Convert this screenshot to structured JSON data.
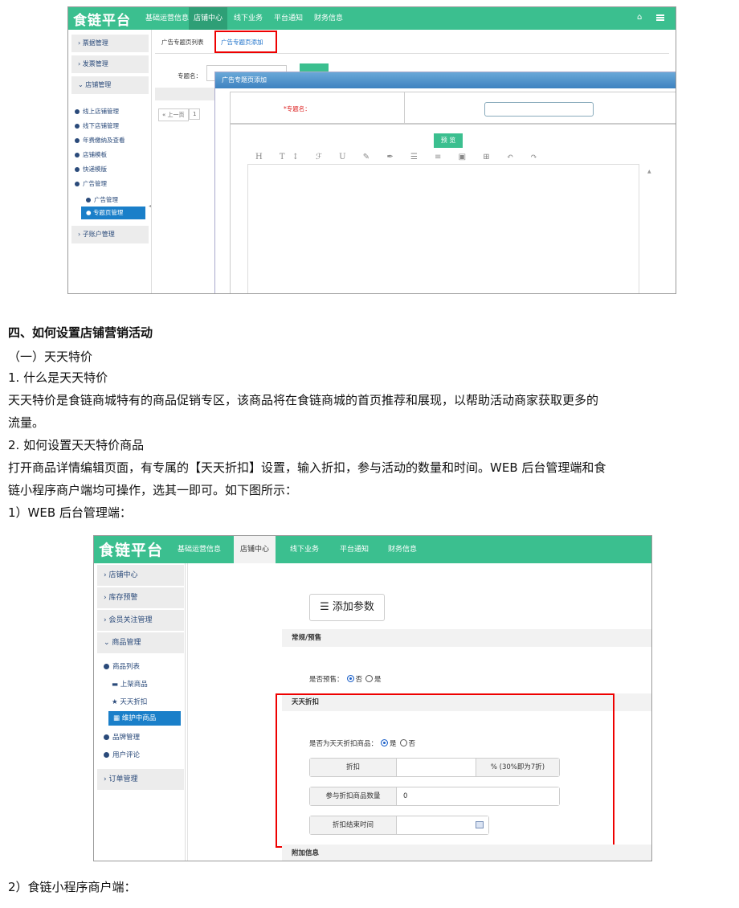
{
  "shot1": {
    "logo": "食链平台",
    "nav": [
      "基础运营信息",
      "店铺中心",
      "线下业务",
      "平台通知",
      "财务信息"
    ],
    "sidebar_sections": [
      "票据管理",
      "发票管理",
      "店铺管理",
      "子账户管理"
    ],
    "sidebar_items": [
      "线上店铺管理",
      "线下店铺管理",
      "年费缴纳及查看",
      "店铺模板",
      "快递模版",
      "广告管理",
      "广告管理"
    ],
    "sidebar_selected": "专题页管理",
    "tabs": [
      "广告专题页列表",
      "广告专题页添加"
    ],
    "filter_label": "专题名：",
    "pager_prev": "« 上一页",
    "pager_page": "1",
    "modal_title": "广告专题页添加",
    "required_label": "*专题名：",
    "preview_button": "预 览",
    "toolbar_glyphs": "H T↕ ℱ U ✎ ✒ ☰ ≡ ▣ ⊞ ↶ ↷"
  },
  "section": {
    "heading": "四、如何设置店铺营销活动",
    "sub1": "（一）天天特价",
    "q1": "1. 什么是天天特价",
    "p1_line1": "天天特价是食链商城特有的商品促销专区，该商品将在食链商城的首页推荐和展现，以帮助活动商家获取更多的",
    "p1_line2": "流量。",
    "q2": "2. 如何设置天天特价商品",
    "p2_line1": "打开商品详情编辑页面，有专属的【天天折扣】设置，输入折扣，参与活动的数量和时间。WEB 后台管理端和食",
    "p2_line2": "链小程序商户端均可操作，选其一即可。如下图所示：",
    "web_label": "1）WEB 后台管理端：",
    "mini_label": "2）食链小程序商户端："
  },
  "shot2": {
    "logo": "食链平台",
    "nav": [
      "基础运营信息",
      "店铺中心",
      "线下业务",
      "平台通知",
      "财务信息"
    ],
    "sidebar_sections": [
      "店铺中心",
      "库存预警",
      "会员关注管理",
      "商品管理",
      "订单管理"
    ],
    "sidebar_items": [
      "商品列表",
      "上架商品",
      "天天折扣",
      "品牌管理",
      "用户评论"
    ],
    "sidebar_selected": "维护中商品",
    "add_param_button": "☰ 添加参数",
    "band_regular": "常规/预售",
    "presale_label": "是否预售：",
    "radio_no": "否",
    "radio_yes": "是",
    "band_discount": "天天折扣",
    "is_discount_label": "是否为天天折扣商品：",
    "discount_label": "折扣",
    "discount_hint": "% (30%即为7折)",
    "qty_label": "参与折扣商品数量",
    "qty_value": "0",
    "end_time_label": "折扣结束时间",
    "band_extra": "附加信息"
  }
}
